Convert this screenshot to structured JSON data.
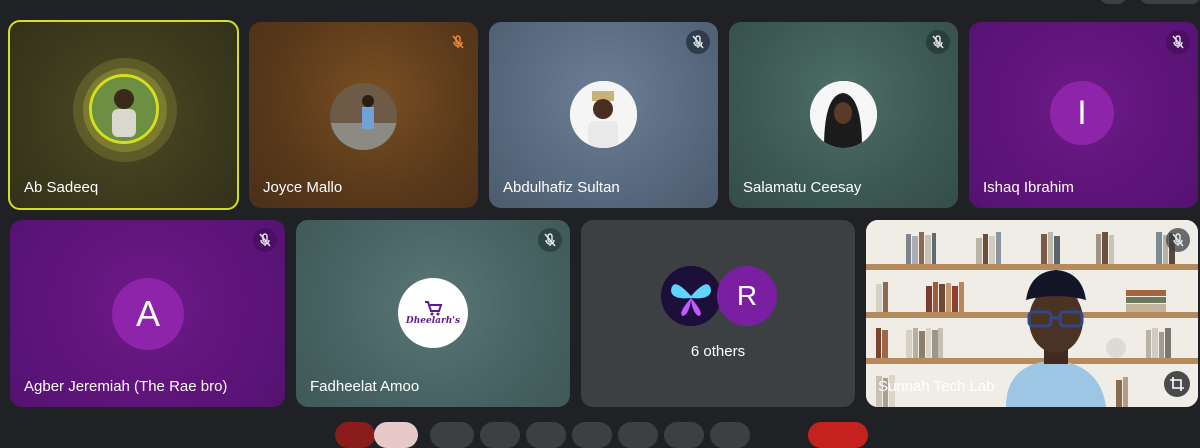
{
  "participants_row1": [
    {
      "name": "Ab Sadeeq",
      "speaking": true,
      "muted": false
    },
    {
      "name": "Joyce Mallo",
      "muted": true
    },
    {
      "name": "Abdulhafiz Sultan",
      "muted": true
    },
    {
      "name": "Salamatu Ceesay",
      "muted": true
    },
    {
      "name": "Ishaq Ibrahim",
      "muted": true,
      "initial": "I"
    }
  ],
  "participants_row2": [
    {
      "name": "Agber Jeremiah (The Rae bro)",
      "muted": true,
      "initial": "A"
    },
    {
      "name": "Fadheelat Amoo",
      "muted": true,
      "logo_text": "Dheelarh's"
    },
    {
      "others_label": "6 others",
      "initial": "R"
    },
    {
      "name": "Sunnah Tech Lab",
      "muted": true
    }
  ],
  "colors": {
    "background": "#202124",
    "speaking_border": "#d4e01e",
    "letter_avatar": "#7b1fa2",
    "purple_tile": "#6a1b9a"
  },
  "icons": {
    "muted": "mic-off-icon",
    "self_view": "crop-icon"
  }
}
